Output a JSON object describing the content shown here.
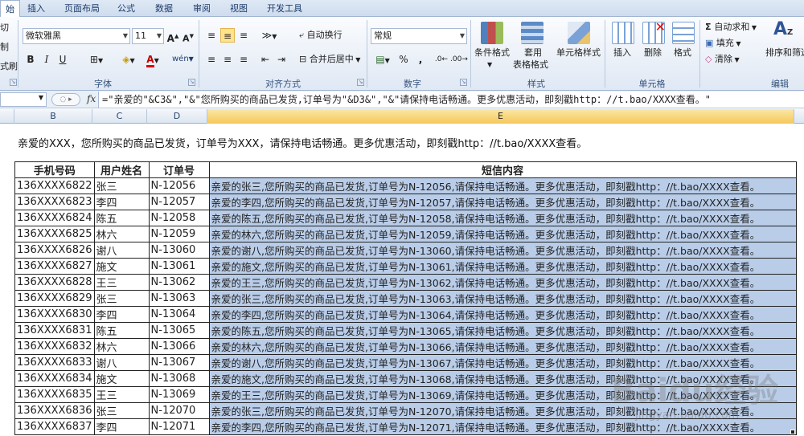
{
  "tabs": [
    "始",
    "插入",
    "页面布局",
    "公式",
    "数据",
    "审阅",
    "视图",
    "开发工具"
  ],
  "ribbon": {
    "font_name": "微软雅黑",
    "font_size": "11",
    "font_group": "字体",
    "align_group": "对齐方式",
    "number_group": "数字",
    "style_group": "样式",
    "cells_group": "单元格",
    "edit_group": "编辑",
    "wrap_text": "自动换行",
    "merge_center": "合并后居中",
    "number_format": "常规",
    "cond_format": "条件格式",
    "table_format_1": "套用",
    "table_format_2": "表格格式",
    "cell_style": "单元格样式",
    "insert": "插入",
    "delete": "删除",
    "format": "格式",
    "autosum": "自动求和",
    "fill": "填充",
    "clear": "清除",
    "sort_filter": "排序和筛选",
    "clipboard_cut": "切",
    "clipboard_copy": "制",
    "clipboard_painter": "式刷",
    "percent": "%",
    "comma": ","
  },
  "formula_bar": {
    "fx": "fx",
    "formula": "=\"亲爱的\"&C3&\",\"&\"您所购买的商品已发货,订单号为\"&D3&\",\"&\"请保持电话畅通。更多优惠活动，即刻戳http：//t.bao/XXXX查看。\""
  },
  "columns": [
    "B",
    "C",
    "D",
    "E"
  ],
  "sheet": {
    "intro": "亲爱的XXX，您所购买的商品已发货，订单号为XXX，请保持电话畅通。更多优惠活动，即刻戳http：//t.bao/XXXX查看。",
    "headers": [
      "手机号码",
      "用户姓名",
      "订单号",
      "短信内容"
    ],
    "rows": [
      [
        "136XXXX6822",
        "张三",
        "N-12056",
        "亲爱的张三,您所购买的商品已发货,订单号为N-12056,请保持电话畅通。更多优惠活动，即刻戳http：//t.bao/XXXX查看。"
      ],
      [
        "136XXXX6823",
        "李四",
        "N-12057",
        "亲爱的李四,您所购买的商品已发货,订单号为N-12057,请保持电话畅通。更多优惠活动，即刻戳http：//t.bao/XXXX查看。"
      ],
      [
        "136XXXX6824",
        "陈五",
        "N-12058",
        "亲爱的陈五,您所购买的商品已发货,订单号为N-12058,请保持电话畅通。更多优惠活动，即刻戳http：//t.bao/XXXX查看。"
      ],
      [
        "136XXXX6825",
        "林六",
        "N-12059",
        "亲爱的林六,您所购买的商品已发货,订单号为N-12059,请保持电话畅通。更多优惠活动，即刻戳http：//t.bao/XXXX查看。"
      ],
      [
        "136XXXX6826",
        "谢八",
        "N-13060",
        "亲爱的谢八,您所购买的商品已发货,订单号为N-13060,请保持电话畅通。更多优惠活动，即刻戳http：//t.bao/XXXX查看。"
      ],
      [
        "136XXXX6827",
        "施文",
        "N-13061",
        "亲爱的施文,您所购买的商品已发货,订单号为N-13061,请保持电话畅通。更多优惠活动，即刻戳http：//t.bao/XXXX查看。"
      ],
      [
        "136XXXX6828",
        "王三",
        "N-13062",
        "亲爱的王三,您所购买的商品已发货,订单号为N-13062,请保持电话畅通。更多优惠活动，即刻戳http：//t.bao/XXXX查看。"
      ],
      [
        "136XXXX6829",
        "张三",
        "N-13063",
        "亲爱的张三,您所购买的商品已发货,订单号为N-13063,请保持电话畅通。更多优惠活动，即刻戳http：//t.bao/XXXX查看。"
      ],
      [
        "136XXXX6830",
        "李四",
        "N-13064",
        "亲爱的李四,您所购买的商品已发货,订单号为N-13064,请保持电话畅通。更多优惠活动，即刻戳http：//t.bao/XXXX查看。"
      ],
      [
        "136XXXX6831",
        "陈五",
        "N-13065",
        "亲爱的陈五,您所购买的商品已发货,订单号为N-13065,请保持电话畅通。更多优惠活动，即刻戳http：//t.bao/XXXX查看。"
      ],
      [
        "136XXXX6832",
        "林六",
        "N-13066",
        "亲爱的林六,您所购买的商品已发货,订单号为N-13066,请保持电话畅通。更多优惠活动，即刻戳http：//t.bao/XXXX查看。"
      ],
      [
        "136XXXX6833",
        "谢八",
        "N-13067",
        "亲爱的谢八,您所购买的商品已发货,订单号为N-13067,请保持电话畅通。更多优惠活动，即刻戳http：//t.bao/XXXX查看。"
      ],
      [
        "136XXXX6834",
        "施文",
        "N-13068",
        "亲爱的施文,您所购买的商品已发货,订单号为N-13068,请保持电话畅通。更多优惠活动，即刻戳http：//t.bao/XXXX查看。"
      ],
      [
        "136XXXX6835",
        "王三",
        "N-13069",
        "亲爱的王三,您所购买的商品已发货,订单号为N-13069,请保持电话畅通。更多优惠活动，即刻戳http：//t.bao/XXXX查看。"
      ],
      [
        "136XXXX6836",
        "张三",
        "N-12070",
        "亲爱的张三,您所购买的商品已发货,订单号为N-12070,请保持电话畅通。更多优惠活动，即刻戳http：//t.bao/XXXX查看。"
      ],
      [
        "136XXXX6837",
        "李四",
        "N-12071",
        "亲爱的李四,您所购买的商品已发货,订单号为N-12071,请保持电话畅通。更多优惠活动，即刻戳http：//t.bao/XXXX查看。"
      ]
    ]
  },
  "watermark": {
    "brand": "Baidu经验",
    "url": "jingyan.baidu.com"
  }
}
